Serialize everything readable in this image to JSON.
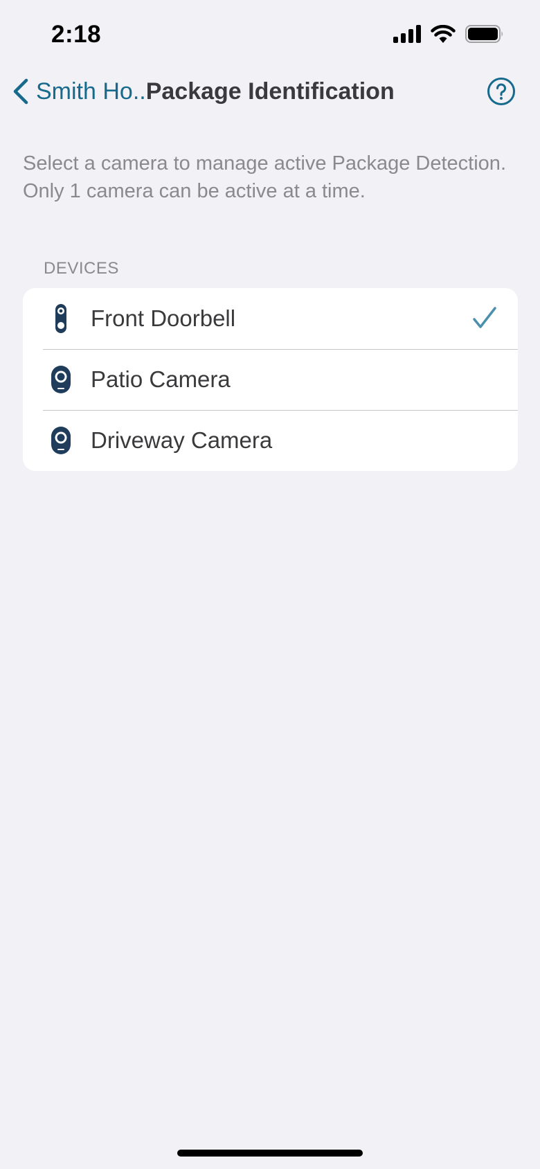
{
  "status_bar": {
    "time": "2:18",
    "icons": [
      "signal-icon",
      "wifi-icon",
      "battery-icon"
    ]
  },
  "nav": {
    "back_label": "Smith Ho..",
    "title": "Package Identification",
    "back_icon": "chevron-left-icon",
    "help_icon": "question-circle-icon"
  },
  "description": "Select a camera to manage active Package Detection. Only 1 camera can be active at a time.",
  "section_header": "DEVICES",
  "devices": [
    {
      "label": "Front Doorbell",
      "icon": "doorbell-icon",
      "selected": true
    },
    {
      "label": "Patio Camera",
      "icon": "camera-icon",
      "selected": false
    },
    {
      "label": "Driveway Camera",
      "icon": "camera-icon",
      "selected": false
    }
  ],
  "colors": {
    "accent": "#176a8c",
    "checkmark": "#4a8fab",
    "device_icon": "#1f3d5a",
    "background": "#f1f1f6",
    "card": "#ffffff",
    "secondary_text": "#8a8a8e",
    "primary_text": "#3a3a3c"
  }
}
